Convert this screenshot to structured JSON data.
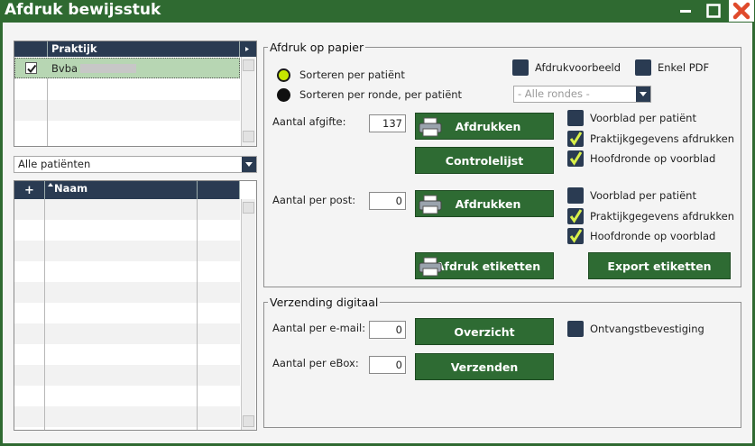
{
  "window": {
    "title": "Afdruk bewijsstuk"
  },
  "practice_grid": {
    "header": "Praktijk",
    "rows": [
      {
        "checked": true,
        "name": "Bvba"
      }
    ]
  },
  "patient_filter": {
    "selected": "Alle patiënten"
  },
  "patient_grid": {
    "add_label": "+",
    "header": "Naam"
  },
  "print_group": {
    "legend": "Afdruk op papier",
    "sort_patient": "Sorteren per patiënt",
    "sort_round": "Sorteren per ronde, per patiënt",
    "print_preview": "Afdrukvoorbeeld",
    "single_pdf": "Enkel PDF",
    "rounds_placeholder": "- Alle rondes -",
    "count_label": "Aantal afgifte:",
    "count_value": "137",
    "print_button": "Afdrukken",
    "control_button": "Controlelijst",
    "opt1_cover": "Voorblad per patiënt",
    "opt1_practice": "Praktijkgegevens afdrukken",
    "opt1_mainround": "Hoofdronde op voorblad",
    "post_label": "Aantal per post:",
    "post_value": "0",
    "print_button2": "Afdrukken",
    "opt2_cover": "Voorblad per patiënt",
    "opt2_practice": "Praktijkgegevens afdrukken",
    "opt2_mainround": "Hoofdronde op voorblad",
    "labels_print": "Afdruk etiketten",
    "labels_export": "Export etiketten"
  },
  "digital_group": {
    "legend": "Verzending digitaal",
    "email_label": "Aantal per e-mail:",
    "email_value": "0",
    "overview_button": "Overzicht",
    "receipt": "Ontvangstbevestiging",
    "ebox_label": "Aantal per eBox:",
    "ebox_value": "0",
    "send_button": "Verzenden"
  },
  "colors": {
    "window": "#2f6a31",
    "button": "#2e6b33",
    "header": "#2a3b52",
    "selected_row": "#b7d6b3"
  }
}
